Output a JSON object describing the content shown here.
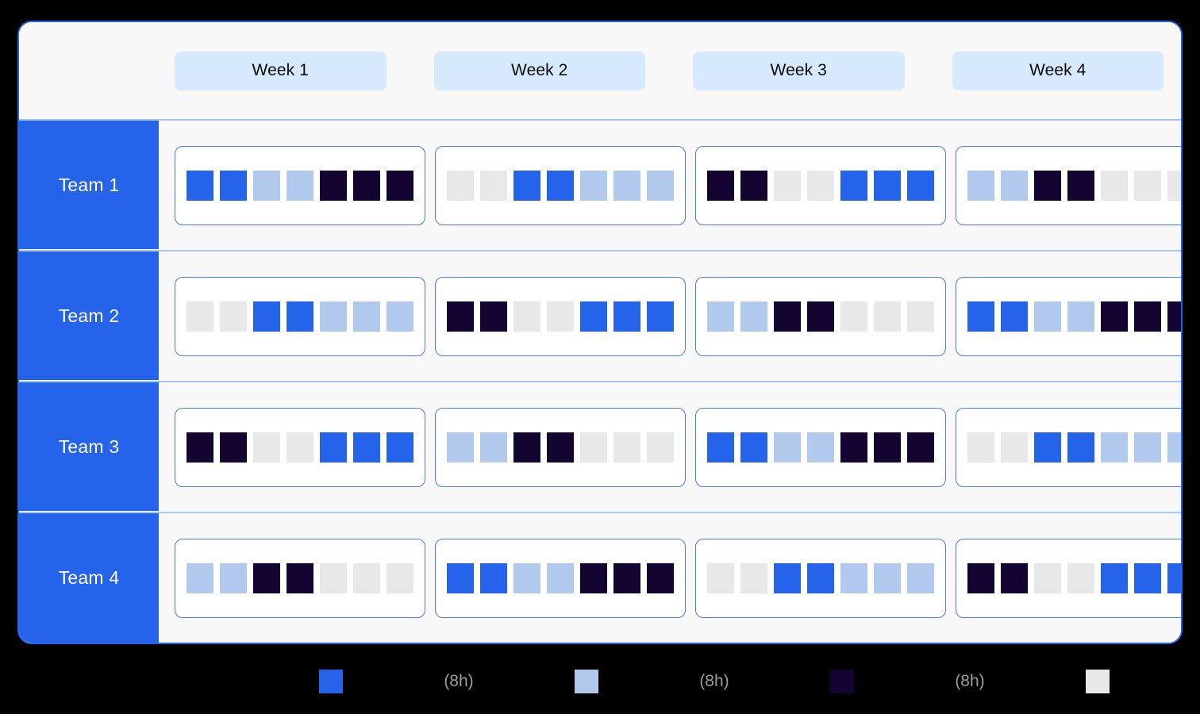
{
  "header": {
    "weeks": [
      {
        "label": "Week 1"
      },
      {
        "label": "Week 2"
      },
      {
        "label": "Week 3"
      },
      {
        "label": "Week 4"
      }
    ]
  },
  "palette": {
    "blue": "#2563EB",
    "light_blue": "#B0C9EC",
    "dark_navy": "#130431",
    "gray": "#E8E8E8",
    "pill_bg": "#D6E9FD",
    "card_bg": "#F8F8F8",
    "divider": "#A9C4F7",
    "page_bg": "#000000"
  },
  "legend": {
    "items": [
      {
        "swatch": "blue",
        "color": "#2563EB",
        "label": "(8h)"
      },
      {
        "swatch": "light_blue",
        "color": "#B0C9EC",
        "label": "(8h)"
      },
      {
        "swatch": "dark_navy",
        "color": "#130431",
        "label": "(8h)"
      },
      {
        "swatch": "gray",
        "color": "#E8E8E8",
        "label": ""
      }
    ]
  },
  "rows": [
    {
      "team": "Team 1",
      "weeks": [
        {
          "cells": [
            "blue",
            "blue",
            "light_blue",
            "light_blue",
            "dark_navy",
            "dark_navy",
            "dark_navy"
          ]
        },
        {
          "cells": [
            "gray",
            "gray",
            "blue",
            "blue",
            "light_blue",
            "light_blue",
            "light_blue"
          ]
        },
        {
          "cells": [
            "dark_navy",
            "dark_navy",
            "gray",
            "gray",
            "blue",
            "blue",
            "blue"
          ]
        },
        {
          "cells": [
            "light_blue",
            "light_blue",
            "dark_navy",
            "dark_navy",
            "gray",
            "gray",
            "gray"
          ]
        }
      ]
    },
    {
      "team": "Team 2",
      "weeks": [
        {
          "cells": [
            "gray",
            "gray",
            "blue",
            "blue",
            "light_blue",
            "light_blue",
            "light_blue"
          ]
        },
        {
          "cells": [
            "dark_navy",
            "dark_navy",
            "gray",
            "gray",
            "blue",
            "blue",
            "blue"
          ]
        },
        {
          "cells": [
            "light_blue",
            "light_blue",
            "dark_navy",
            "dark_navy",
            "gray",
            "gray",
            "gray"
          ]
        },
        {
          "cells": [
            "blue",
            "blue",
            "light_blue",
            "light_blue",
            "dark_navy",
            "dark_navy",
            "dark_navy"
          ]
        }
      ]
    },
    {
      "team": "Team 3",
      "weeks": [
        {
          "cells": [
            "dark_navy",
            "dark_navy",
            "gray",
            "gray",
            "blue",
            "blue",
            "blue"
          ]
        },
        {
          "cells": [
            "light_blue",
            "light_blue",
            "dark_navy",
            "dark_navy",
            "gray",
            "gray",
            "gray"
          ]
        },
        {
          "cells": [
            "blue",
            "blue",
            "light_blue",
            "light_blue",
            "dark_navy",
            "dark_navy",
            "dark_navy"
          ]
        },
        {
          "cells": [
            "gray",
            "gray",
            "blue",
            "blue",
            "light_blue",
            "light_blue",
            "light_blue"
          ]
        }
      ]
    },
    {
      "team": "Team 4",
      "weeks": [
        {
          "cells": [
            "light_blue",
            "light_blue",
            "dark_navy",
            "dark_navy",
            "gray",
            "gray",
            "gray"
          ]
        },
        {
          "cells": [
            "blue",
            "blue",
            "light_blue",
            "light_blue",
            "dark_navy",
            "dark_navy",
            "dark_navy"
          ]
        },
        {
          "cells": [
            "gray",
            "gray",
            "blue",
            "blue",
            "light_blue",
            "light_blue",
            "light_blue"
          ]
        },
        {
          "cells": [
            "dark_navy",
            "dark_navy",
            "gray",
            "gray",
            "blue",
            "blue",
            "blue"
          ]
        }
      ]
    }
  ]
}
